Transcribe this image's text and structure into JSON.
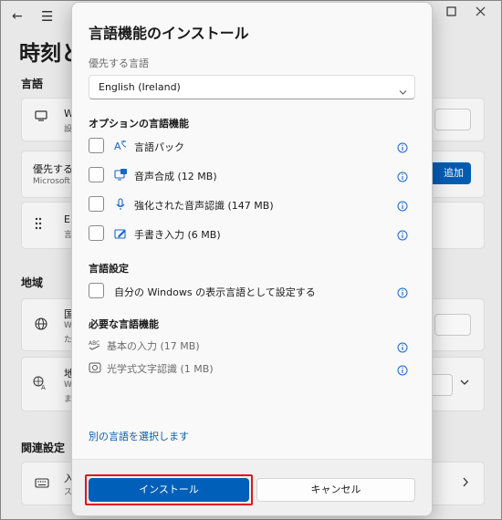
{
  "background": {
    "back_glyph": "←",
    "menu_glyph": "☰",
    "page_title": "時刻と",
    "sections": {
      "language": "言語",
      "region": "地域",
      "related": "関連設定"
    },
    "cards": {
      "display_lang": {
        "text": "W",
        "sub": "設"
      },
      "preferred": {
        "text": "優先する",
        "sub": "Microsoft"
      },
      "english": {
        "text": "E",
        "sub": "言"
      },
      "country": {
        "text": "国",
        "sub1": "W",
        "sub2": "た"
      },
      "regional": {
        "text": "地",
        "sub1": "W",
        "sub2": "ま"
      },
      "typing": {
        "text": "入",
        "sub": "ス"
      }
    },
    "add_button_label": "追加"
  },
  "dialog": {
    "title": "言語機能のインストール",
    "preferred_label": "優先する言語",
    "language_select_value": "English (Ireland)",
    "optional_header": "オプションの言語機能",
    "optional_features": [
      {
        "label": "言語パック",
        "icon": "language-pack-icon"
      },
      {
        "label": "音声合成 (12 MB)",
        "icon": "text-to-speech-icon"
      },
      {
        "label": "強化された音声認識 (147 MB)",
        "icon": "microphone-icon"
      },
      {
        "label": "手書き入力 (6 MB)",
        "icon": "pen-icon"
      }
    ],
    "settings_header": "言語設定",
    "settings_option": "自分の Windows の表示言語として設定する",
    "required_header": "必要な言語機能",
    "required_features": [
      {
        "label": "基本の入力 (17 MB)",
        "icon": "abc-icon"
      },
      {
        "label": "光学式文字認識 (1 MB)",
        "icon": "ocr-icon"
      }
    ],
    "other_language_link": "別の言語を選択します",
    "install_label": "インストール",
    "cancel_label": "キャンセル"
  },
  "colors": {
    "accent": "#005fb8",
    "icon_blue": "#1a66c4",
    "highlight": "#e0141e"
  }
}
